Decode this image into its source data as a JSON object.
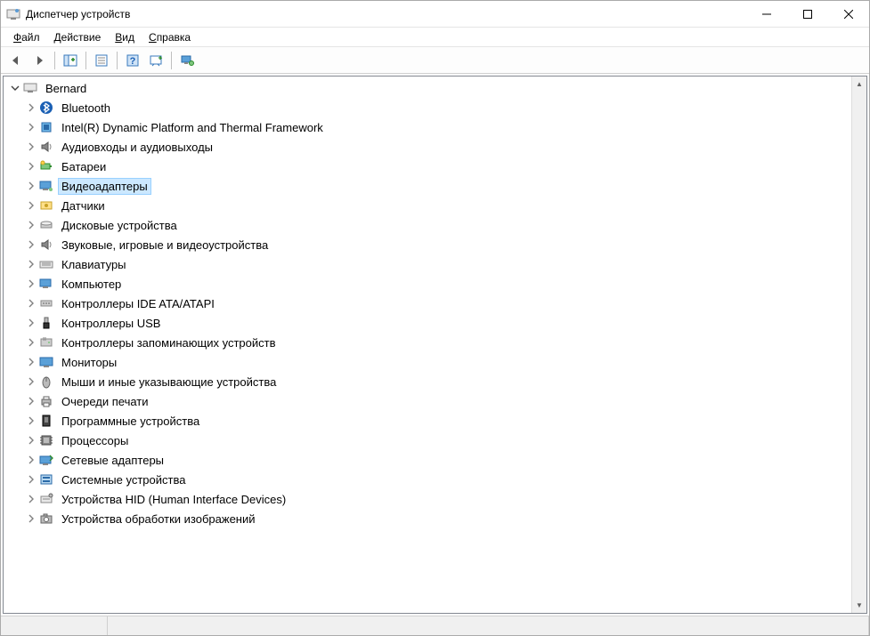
{
  "window": {
    "title": "Диспетчер устройств"
  },
  "menu": {
    "file": "Файл",
    "action": "Действие",
    "view": "Вид",
    "help": "Справка"
  },
  "tree": {
    "root": {
      "label": "Bernard",
      "expanded": true
    },
    "items": [
      {
        "id": "bluetooth",
        "label": "Bluetooth",
        "icon": "bluetooth"
      },
      {
        "id": "intel-dptf",
        "label": "Intel(R) Dynamic Platform and Thermal Framework",
        "icon": "chip"
      },
      {
        "id": "audio-io",
        "label": "Аудиовходы и аудиовыходы",
        "icon": "speaker"
      },
      {
        "id": "batteries",
        "label": "Батареи",
        "icon": "battery"
      },
      {
        "id": "display-adapters",
        "label": "Видеоадаптеры",
        "icon": "display",
        "selected": true
      },
      {
        "id": "sensors",
        "label": "Датчики",
        "icon": "sensor"
      },
      {
        "id": "disk-drives",
        "label": "Дисковые устройства",
        "icon": "disk"
      },
      {
        "id": "sound-game",
        "label": "Звуковые, игровые и видеоустройства",
        "icon": "speaker"
      },
      {
        "id": "keyboards",
        "label": "Клавиатуры",
        "icon": "keyboard"
      },
      {
        "id": "computer",
        "label": "Компьютер",
        "icon": "computer"
      },
      {
        "id": "ide-ata",
        "label": "Контроллеры IDE ATA/ATAPI",
        "icon": "ide"
      },
      {
        "id": "usb",
        "label": "Контроллеры USB",
        "icon": "usb"
      },
      {
        "id": "storage-ctrl",
        "label": "Контроллеры запоминающих устройств",
        "icon": "storage"
      },
      {
        "id": "monitors",
        "label": "Мониторы",
        "icon": "monitor"
      },
      {
        "id": "mice",
        "label": "Мыши и иные указывающие устройства",
        "icon": "mouse"
      },
      {
        "id": "print-queues",
        "label": "Очереди печати",
        "icon": "printer"
      },
      {
        "id": "software-devices",
        "label": "Программные устройства",
        "icon": "softdev"
      },
      {
        "id": "processors",
        "label": "Процессоры",
        "icon": "cpu"
      },
      {
        "id": "network-adapters",
        "label": "Сетевые адаптеры",
        "icon": "network"
      },
      {
        "id": "system-devices",
        "label": "Системные устройства",
        "icon": "system"
      },
      {
        "id": "hid",
        "label": "Устройства HID (Human Interface Devices)",
        "icon": "hid"
      },
      {
        "id": "imaging",
        "label": "Устройства обработки изображений",
        "icon": "camera"
      }
    ]
  }
}
